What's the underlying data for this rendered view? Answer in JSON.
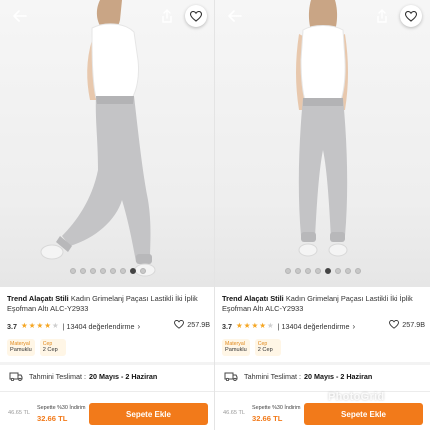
{
  "product": {
    "brand": "Trend Alaçatı Stili",
    "name": "Kadın Grimelanj Paçası Lastikli İki İplik Eşofman Altı ALC-Y2933",
    "rating": "3.7",
    "rating_stars": 3.7,
    "reviews": "| 13404 değerlendirme",
    "likes": "257.9B",
    "attributes": [
      {
        "key": "Materyal",
        "value": "Pamuklu"
      },
      {
        "key": "Cep",
        "value": "2 Cep"
      }
    ]
  },
  "delivery": {
    "label": "Tahmini Teslimat :",
    "value": "20 Mayıs - 2 Haziran"
  },
  "pricing": {
    "old_price": "46.65 TL",
    "campaign": "Sepette %30 İndirim",
    "new_price": "32.66 TL",
    "add_to_cart": "Sepete Ekle"
  },
  "panels": [
    {
      "id": "left",
      "image_count": 8,
      "active_index": 6
    },
    {
      "id": "right",
      "image_count": 8,
      "active_index": 4
    }
  ],
  "icons": {
    "back": "arrow-left-icon",
    "share": "share-icon",
    "favorite": "heart-icon",
    "truck": "truck-icon",
    "likes": "heart-outline-icon"
  },
  "colors": {
    "accent": "#f27a1a",
    "star": "#f5a623",
    "chip_bg": "#fff6e6",
    "chip_key": "#e08a1e"
  },
  "watermark": "PhotoGrid"
}
